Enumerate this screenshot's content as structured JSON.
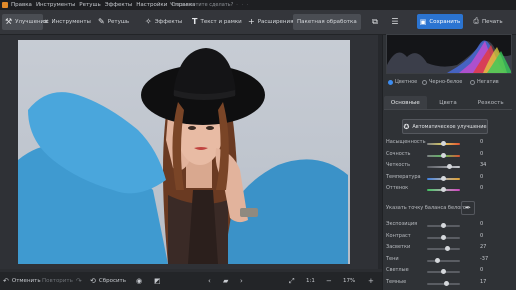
{
  "menubar": {
    "items": [
      "Правка",
      "Инструменты",
      "Ретушь",
      "Эффекты",
      "Настройки",
      "Справка"
    ],
    "search_placeholder": "Что вы хотите сделать?"
  },
  "toolbar": {
    "tools": [
      {
        "label": "Улучшения",
        "icon": "wand-icon"
      },
      {
        "label": "Инструменты",
        "icon": "crop-icon"
      },
      {
        "label": "Ретушь",
        "icon": "brush-icon"
      },
      {
        "label": "Эффекты",
        "icon": "sparkle-icon"
      },
      {
        "label": "Текст и рамки",
        "icon": "text-icon"
      },
      {
        "label": "Расширения",
        "icon": "plus-icon"
      },
      {
        "label": "Пакетная обработка",
        "icon": ""
      }
    ],
    "save_label": "Сохранить",
    "print_label": "Печать"
  },
  "bottombar": {
    "undo_label": "Отменить",
    "redo_label": "Повторить",
    "reset_label": "Сбросить",
    "ratio_label": "1:1",
    "zoom_value": "17%",
    "zoom_fraction": 0.17
  },
  "panel": {
    "modes": [
      "Цветное",
      "Черно-белое",
      "Негатив"
    ],
    "selected_mode": 0,
    "tabs": [
      "Основные",
      "Цвета",
      "Резкость"
    ],
    "active_tab": 0,
    "auto_button_label": "Автоматическое улучшение",
    "sliders_top": [
      {
        "label": "Насыщенность",
        "value": "0",
        "position": 0.5,
        "gradient": "#7d7f84,#e0d060,#e05030"
      },
      {
        "label": "Сочность",
        "value": "0",
        "position": 0.5,
        "gradient": "#7d7f84,#60c060,#e05030"
      },
      {
        "label": "Четкость",
        "value": "34",
        "position": 0.67,
        "gradient": "#5a5d63,#8a8d93,#c8cbd0"
      },
      {
        "label": "Температура",
        "value": "0",
        "position": 0.5,
        "gradient": "#3d7fe0,#b0b0b0,#e0a030"
      },
      {
        "label": "Оттенок",
        "value": "0",
        "position": 0.5,
        "gradient": "#40c060,#b0b0b0,#d040c0"
      }
    ],
    "white_balance_label": "Указать точку баланса белого",
    "sliders_bottom": [
      {
        "label": "Экспозиция",
        "value": "0",
        "position": 0.5
      },
      {
        "label": "Контраст",
        "value": "0",
        "position": 0.5
      },
      {
        "label": "Засветки",
        "value": "27",
        "position": 0.63
      },
      {
        "label": "Тени",
        "value": "-37",
        "position": 0.32
      },
      {
        "label": "Светлые",
        "value": "0",
        "position": 0.5
      },
      {
        "label": "Темные",
        "value": "17",
        "position": 0.58
      }
    ]
  }
}
